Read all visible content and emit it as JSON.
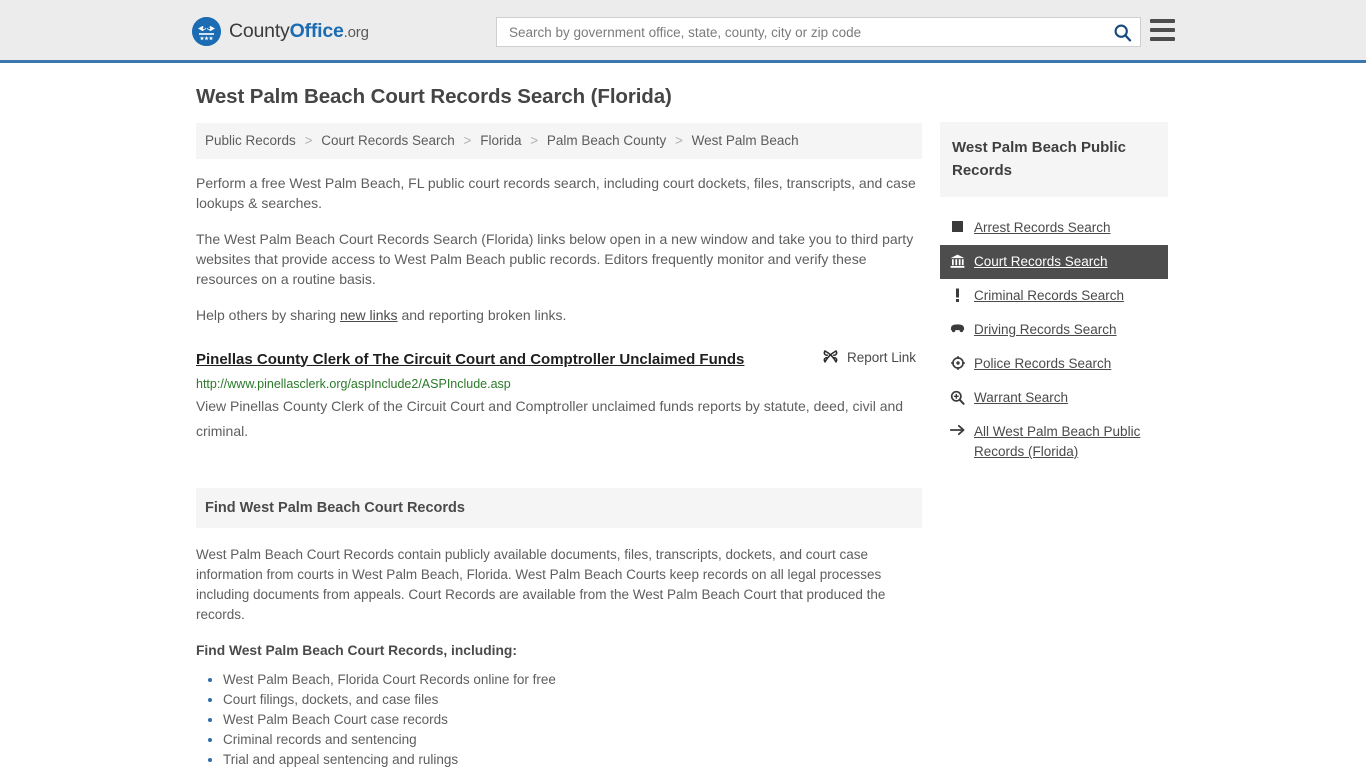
{
  "header": {
    "brand": {
      "part1": "County",
      "part2": "Office",
      "part3": ".org",
      "logo_icon": "eagle-shield-logo"
    },
    "search": {
      "placeholder": "Search by government office, state, county, city or zip code",
      "value": "",
      "button_icon": "search-icon"
    },
    "menu_icon": "hamburger-menu-icon",
    "accent_color": "#3b76ad"
  },
  "main": {
    "title": "West Palm Beach Court Records Search (Florida)",
    "breadcrumb": [
      "Public Records",
      "Court Records Search",
      "Florida",
      "Palm Beach County",
      "West Palm Beach"
    ],
    "breadcrumb_separator": ">",
    "intro_paragraph": "Perform a free West Palm Beach, FL public court records search, including court dockets, files, transcripts, and case lookups & searches.",
    "description_paragraph": "The West Palm Beach Court Records Search (Florida) links below open in a new window and take you to third party websites that provide access to West Palm Beach public records. Editors frequently monitor and verify these resources on a routine basis.",
    "help_prefix": "Help others by sharing ",
    "help_link": "new links",
    "help_suffix": " and reporting broken links.",
    "result": {
      "title": "Pinellas County Clerk of The Circuit Court and Comptroller Unclaimed Funds",
      "report_label": "Report Link",
      "report_icon": "broken-link-icon",
      "url": "http://www.pinellasclerk.org/aspInclude2/ASPInclude.asp",
      "url_color": "#2a7a2a",
      "description": "View Pinellas County Clerk of the Circuit Court and Comptroller unclaimed funds reports by statute, deed, civil and criminal."
    },
    "section": {
      "heading": "Find West Palm Beach Court Records",
      "body": "West Palm Beach Court Records contain publicly available documents, files, transcripts, dockets, and court case information from courts in West Palm Beach, Florida. West Palm Beach Courts keep records on all legal processes including documents from appeals. Court Records are available from the West Palm Beach Court that produced the records.",
      "subheading": "Find West Palm Beach Court Records, including:",
      "items": [
        "West Palm Beach, Florida Court Records online for free",
        "Court filings, dockets, and case files",
        "West Palm Beach Court case records",
        "Criminal records and sentencing",
        "Trial and appeal sentencing and rulings"
      ]
    }
  },
  "sidebar": {
    "title": "West Palm Beach Public Records",
    "active_color": "#4d4d4d",
    "items": [
      {
        "label": "Arrest Records Search",
        "icon": "square-icon",
        "active": false
      },
      {
        "label": "Court Records Search",
        "icon": "courthouse-icon",
        "active": true
      },
      {
        "label": "Criminal Records Search",
        "icon": "exclamation-icon",
        "active": false
      },
      {
        "label": "Driving Records Search",
        "icon": "car-icon",
        "active": false
      },
      {
        "label": "Police Records Search",
        "icon": "police-badge-icon",
        "active": false
      },
      {
        "label": "Warrant Search",
        "icon": "magnifier-plus-icon",
        "active": false
      },
      {
        "label": "All West Palm Beach Public Records (Florida)",
        "icon": "arrow-right-icon",
        "active": false
      }
    ]
  }
}
